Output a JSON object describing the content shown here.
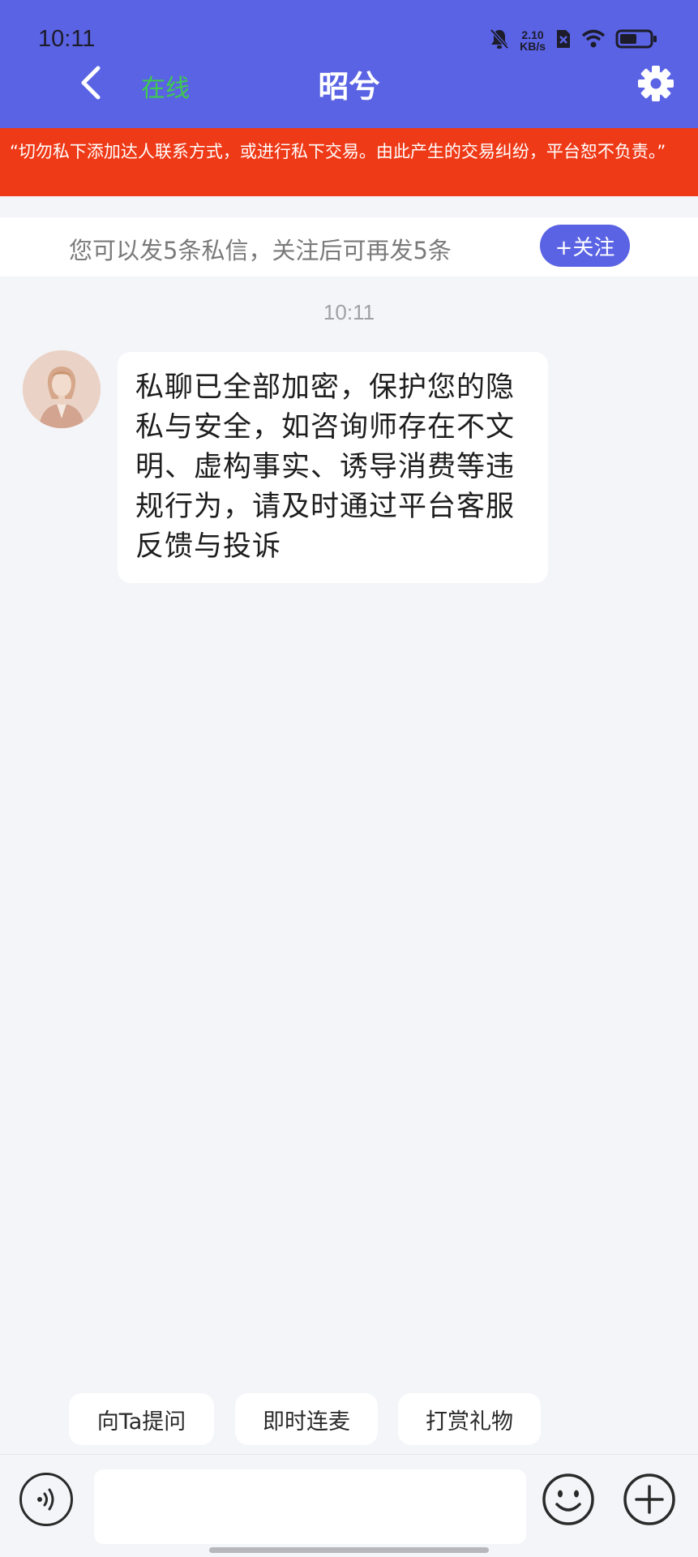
{
  "status_bar": {
    "time": "10:11",
    "net_speed_value": "2.10",
    "net_speed_unit": "KB/s",
    "icons": [
      "bell-muted-icon",
      "sim-x-icon",
      "wifi-icon",
      "battery-icon"
    ]
  },
  "header": {
    "back_icon": "chevron-left-icon",
    "status": "在线",
    "title": "昭兮",
    "settings_icon": "gear-icon"
  },
  "warning": {
    "text": "“切勿私下添加达人联系方式，或进行私下交易。由此产生的交易纠纷，平台恕不负责。”"
  },
  "quota": {
    "text": "您可以发5条私信，关注后可再发5条",
    "follow_label": "+关注"
  },
  "chat": {
    "timestamp": "10:11",
    "messages": [
      {
        "sender": "counselor",
        "text": "私聊已全部加密，保护您的隐私与安全，如咨询师存在不文明、虚构事实、诱导消费等违规行为，请及时通过平台客服反馈与投诉"
      }
    ]
  },
  "quick_actions": [
    {
      "label": "向Ta提问"
    },
    {
      "label": "即时连麦"
    },
    {
      "label": "打赏礼物"
    }
  ],
  "input_bar": {
    "voice_icon": "voice-icon",
    "message_value": "",
    "emoji_icon": "smile-icon",
    "plus_icon": "plus-circle-icon"
  },
  "colors": {
    "brand": "#5a63e3",
    "warning": "#ef3a17",
    "online": "#3fca4f",
    "background": "#f4f5f9"
  }
}
